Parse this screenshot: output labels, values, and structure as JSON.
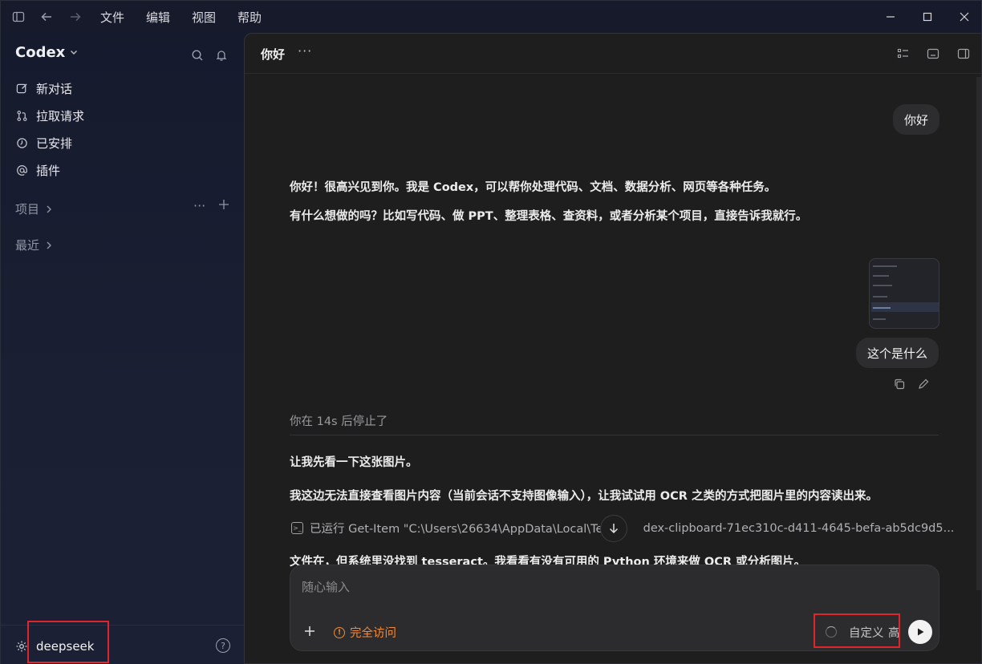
{
  "menu": {
    "items": [
      "文件",
      "编辑",
      "视图",
      "帮助"
    ]
  },
  "sidebar": {
    "brand": "Codex",
    "nav": [
      {
        "label": "新对话",
        "icon": "edit-icon"
      },
      {
        "label": "拉取请求",
        "icon": "pull-request-icon"
      },
      {
        "label": "已安排",
        "icon": "clock-icon"
      },
      {
        "label": "插件",
        "icon": "at-icon"
      }
    ],
    "sections": {
      "projects": "项目",
      "recent": "最近"
    },
    "user": "deepseek"
  },
  "thread": {
    "title": "你好",
    "messages": {
      "user1": "你好",
      "assistant1_line1": "你好！很高兴见到你。我是 Codex，可以帮你处理代码、文档、数据分析、网页等各种任务。",
      "assistant1_line2": "有什么想做的吗？比如写代码、做 PPT、整理表格、查资料，或者分析某个项目，直接告诉我就行。",
      "user2": "这个是什么",
      "stopped_note": "你在 14s 后停止了",
      "assistant2_line1": "让我先看一下这张图片。",
      "assistant2_line2": "我这边无法直接查看图片内容（当前会话不支持图像输入），让我试试用 OCR 之类的方式把图片里的内容读出来。",
      "run_command": "已运行 Get-Item \"C:\\Users\\26634\\AppData\\Local\\Tem",
      "run_command_tail": "dex-clipboard-71ec310c-d411-4645-befa-ab5dc9d5...",
      "assistant2_line3": "文件在，但系统里没找到 tesseract。我看看有没有可用的 Python 环境来做 OCR 或分析图片。"
    }
  },
  "composer": {
    "placeholder": "随心输入",
    "access_label": "完全访问",
    "model_label": "自定义",
    "level_label": "高"
  },
  "colors": {
    "accent_warning": "#f08a3c",
    "highlight_box": "#e0262b"
  }
}
